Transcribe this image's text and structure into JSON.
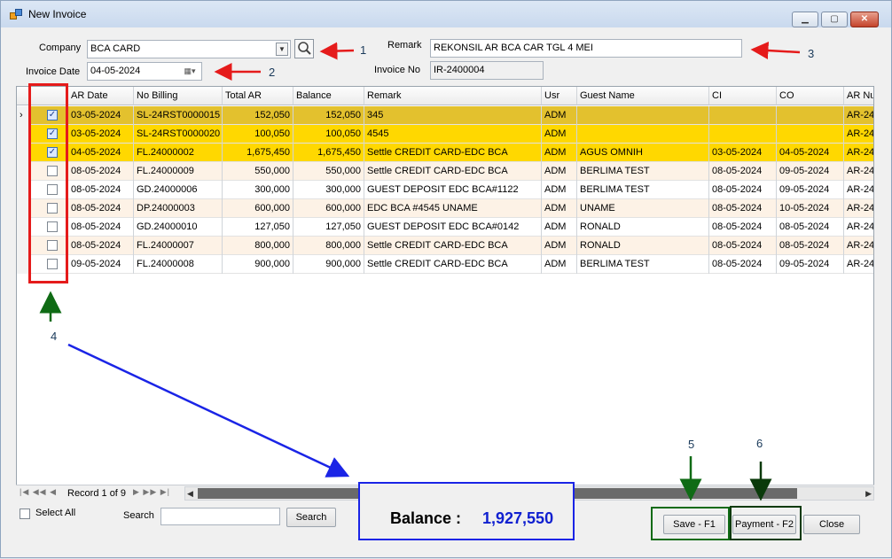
{
  "window": {
    "title": "New Invoice",
    "controls": {
      "minimize": "▁",
      "maximize": "▢",
      "close": "✕"
    }
  },
  "form": {
    "company_label": "Company",
    "company_value": "BCA CARD",
    "invoice_date_label": "Invoice Date",
    "invoice_date_value": "04-05-2024",
    "remark_label": "Remark",
    "remark_value": "REKONSIL AR BCA CAR TGL 4 MEI",
    "invoice_no_label": "Invoice No",
    "invoice_no_value": "IR-2400004"
  },
  "grid": {
    "columns": [
      "AR Date",
      "No Billing",
      "Total AR",
      "Balance",
      "Remark",
      "Usr",
      "Guest Name",
      "CI",
      "CO",
      "AR Nu"
    ],
    "rows": [
      {
        "checked": true,
        "ar_date": "03-05-2024",
        "no_billing": "SL-24RST0000015",
        "total_ar": "152,050",
        "balance": "152,050",
        "remark": "345",
        "usr": "ADM",
        "guest": "",
        "ci": "",
        "co": "",
        "ar_no": "AR-24"
      },
      {
        "checked": true,
        "ar_date": "03-05-2024",
        "no_billing": "SL-24RST0000020",
        "total_ar": "100,050",
        "balance": "100,050",
        "remark": "4545",
        "usr": "ADM",
        "guest": "",
        "ci": "",
        "co": "",
        "ar_no": "AR-24"
      },
      {
        "checked": true,
        "ar_date": "04-05-2024",
        "no_billing": "FL.24000002",
        "total_ar": "1,675,450",
        "balance": "1,675,450",
        "remark": "Settle CREDIT CARD-EDC BCA",
        "usr": "ADM",
        "guest": "AGUS OMNIH",
        "ci": "03-05-2024",
        "co": "04-05-2024",
        "ar_no": "AR-24"
      },
      {
        "checked": false,
        "ar_date": "08-05-2024",
        "no_billing": "FL.24000009",
        "total_ar": "550,000",
        "balance": "550,000",
        "remark": "Settle CREDIT CARD-EDC BCA",
        "usr": "ADM",
        "guest": "BERLIMA TEST",
        "ci": "08-05-2024",
        "co": "09-05-2024",
        "ar_no": "AR-24"
      },
      {
        "checked": false,
        "ar_date": "08-05-2024",
        "no_billing": "GD.24000006",
        "total_ar": "300,000",
        "balance": "300,000",
        "remark": "GUEST DEPOSIT EDC BCA#1122",
        "usr": "ADM",
        "guest": "BERLIMA TEST",
        "ci": "08-05-2024",
        "co": "09-05-2024",
        "ar_no": "AR-24"
      },
      {
        "checked": false,
        "ar_date": "08-05-2024",
        "no_billing": "DP.24000003",
        "total_ar": "600,000",
        "balance": "600,000",
        "remark": "EDC BCA #4545 UNAME",
        "usr": "ADM",
        "guest": "UNAME",
        "ci": "08-05-2024",
        "co": "10-05-2024",
        "ar_no": "AR-24"
      },
      {
        "checked": false,
        "ar_date": "08-05-2024",
        "no_billing": "GD.24000010",
        "total_ar": "127,050",
        "balance": "127,050",
        "remark": "GUEST DEPOSIT EDC BCA#0142",
        "usr": "ADM",
        "guest": "RONALD",
        "ci": "08-05-2024",
        "co": "08-05-2024",
        "ar_no": "AR-24"
      },
      {
        "checked": false,
        "ar_date": "08-05-2024",
        "no_billing": "FL.24000007",
        "total_ar": "800,000",
        "balance": "800,000",
        "remark": "Settle CREDIT CARD-EDC BCA",
        "usr": "ADM",
        "guest": "RONALD",
        "ci": "08-05-2024",
        "co": "08-05-2024",
        "ar_no": "AR-24"
      },
      {
        "checked": false,
        "ar_date": "09-05-2024",
        "no_billing": "FL.24000008",
        "total_ar": "900,000",
        "balance": "900,000",
        "remark": "Settle CREDIT CARD-EDC BCA",
        "usr": "ADM",
        "guest": "BERLIMA TEST",
        "ci": "08-05-2024",
        "co": "09-05-2024",
        "ar_no": "AR-24"
      }
    ],
    "current_row_marker": "›",
    "check_mark": "✓"
  },
  "navigator": {
    "record_text": "Record 1 of 9",
    "first_prev": "|◀ ◀◀ ◀",
    "next_last": "▶ ▶▶ ▶|",
    "scroll_left": "◀",
    "scroll_right": "▶",
    "grip": "|||"
  },
  "footer": {
    "select_all_label": "Select All",
    "search_label": "Search",
    "search_value": "",
    "search_button": "Search",
    "balance_label": "Balance :",
    "balance_value": "1,927,550",
    "save_button": "Save - F1",
    "payment_button": "Payment - F2",
    "close_button": "Close"
  },
  "annotations": [
    "1",
    "2",
    "3",
    "4",
    "5",
    "6"
  ],
  "colors": {
    "selected_row": "#e3c12e",
    "checked_row": "#ffd800",
    "alt_row": "#fdf2e6",
    "balance_value": "#1020d0",
    "arrow_red": "#e51b1b",
    "arrow_blue": "#1a24e6",
    "arrow_green": "#0f6b15"
  },
  "icons": {
    "search": "magnifier-icon",
    "calendar": "calendar-icon",
    "dropdown": "chevron-down-icon"
  }
}
